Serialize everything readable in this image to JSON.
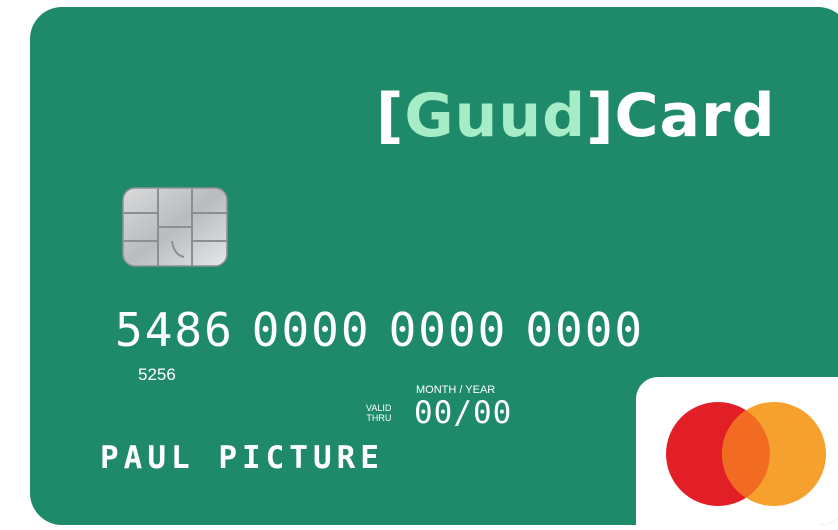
{
  "brand": {
    "open_bracket": "[",
    "name_accent": "Guud",
    "close_bracket": "]",
    "name_rest": "Card",
    "accent_color": "#a6ecc6",
    "card_color": "#1f8a69"
  },
  "card": {
    "number_groups": [
      "5486",
      "0000",
      "0000",
      "0000"
    ],
    "small_number": "5256",
    "month_year_label": "MONTH / YEAR",
    "valid_label": "VALID",
    "thru_label": "THRU",
    "expiry": "00/00",
    "holder_name": "PAUL PICTURE"
  },
  "network": {
    "logo": "mastercard-logo",
    "colors": [
      "#e21f26",
      "#f6a12d",
      "#f26b22"
    ]
  }
}
